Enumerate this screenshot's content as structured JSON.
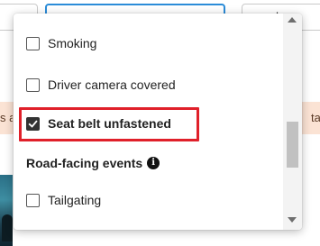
{
  "background": {
    "right_select_label": "ed",
    "banner_left_text": "s a",
    "banner_right_text": "tak",
    "banner_color": "#fbe3d4",
    "active_select_border_color": "#2b8cd8"
  },
  "dropdown": {
    "options": [
      {
        "label": "Smoking",
        "checked": false
      },
      {
        "label": "Driver camera covered",
        "checked": false
      },
      {
        "label": "Seat belt unfastened",
        "checked": true
      },
      {
        "label": "Tailgating",
        "checked": false
      }
    ],
    "section_heading": "Road-facing events",
    "info_icon_glyph": "i",
    "highlight_color": "#e0202a"
  }
}
